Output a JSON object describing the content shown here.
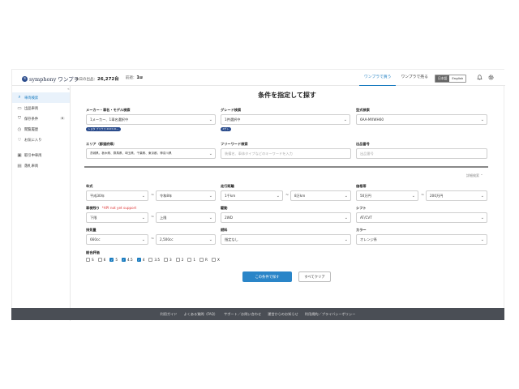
{
  "header": {
    "logo_mark": "s",
    "logo_text": "symphony ワンプラ",
    "stats": [
      {
        "label": "本日の出品：",
        "value": "26,272台"
      },
      {
        "label": "前週：",
        "value": "1u"
      }
    ],
    "tabs": [
      {
        "label": "ワンプラで買う",
        "active": true
      },
      {
        "label": "ワンプラで売る",
        "active": false
      }
    ],
    "lang": {
      "jp": "日本語",
      "en": "English"
    },
    "icons": [
      "bell-icon",
      "gear-icon"
    ]
  },
  "sidebar": {
    "collapse_glyph": "«",
    "items": [
      {
        "label": "車両検索",
        "icon": "search-icon",
        "active": true
      },
      {
        "label": "出品車両",
        "icon": "car-icon",
        "active": false
      },
      {
        "label": "保存条件",
        "icon": "bookmark-icon",
        "active": false,
        "badge": "8"
      },
      {
        "label": "閲覧履歴",
        "icon": "clock-icon",
        "active": false
      },
      {
        "label": "お気に入り",
        "icon": "heart-icon",
        "active": false
      },
      {
        "label": "取引中車両",
        "icon": "deal-icon",
        "active": false
      },
      {
        "label": "落札車両",
        "icon": "document-icon",
        "active": false
      }
    ]
  },
  "form": {
    "title": "条件を指定して探す",
    "maker": {
      "label": "メーカー・車名・モデル検索",
      "value": "1メーカー、1車名選択中",
      "chip": "トヨタ プリウス 2023.01~"
    },
    "grade": {
      "label": "グレード検索",
      "value": "1件選択中",
      "chip": "Zグレ"
    },
    "model_code": {
      "label": "型式検索",
      "value": "6AA-MXWH60"
    },
    "area": {
      "label": "エリア（都道府県）",
      "value": "茨城県、栃木県、群馬県、埼玉県、千葉県、東京都、神奈川県"
    },
    "freeword": {
      "label": "フリーワード検索",
      "placeholder": "装備名、車体タイプなどのキーワードを入力"
    },
    "listing_no": {
      "label": "出品番号",
      "placeholder": "出品番号"
    },
    "detail_toggle": "詳細検索 ⌃",
    "year": {
      "label": "年式",
      "from": "平成30年",
      "to": "令和8年"
    },
    "mileage": {
      "label": "走行距離",
      "from": "1千km",
      "to": "8万km"
    },
    "budget": {
      "label": "価格帯",
      "from": "50万円",
      "to": "200万円"
    },
    "inspection": {
      "label": "車検残り",
      "warn": "*API not yet support",
      "from": "下限",
      "to": "上限"
    },
    "drive": {
      "label": "駆動",
      "value": "2WD"
    },
    "shift": {
      "label": "シフト",
      "value": "AT/CVT"
    },
    "displacement": {
      "label": "排気量",
      "from": "660cc",
      "to": "2,500cc"
    },
    "fuel": {
      "label": "燃料",
      "value": "指定なし"
    },
    "color": {
      "label": "カラー",
      "value": "オレンジ系"
    },
    "rating": {
      "label": "総合評価",
      "options": [
        {
          "label": "S",
          "checked": false
        },
        {
          "label": "6",
          "checked": false
        },
        {
          "label": "5",
          "checked": true
        },
        {
          "label": "4.5",
          "checked": true
        },
        {
          "label": "4",
          "checked": true
        },
        {
          "label": "3.5",
          "checked": false
        },
        {
          "label": "3",
          "checked": false
        },
        {
          "label": "2",
          "checked": false
        },
        {
          "label": "1",
          "checked": false
        },
        {
          "label": "R",
          "checked": false
        },
        {
          "label": "X",
          "checked": false
        }
      ]
    },
    "search_button": "この条件で探す",
    "clear_button": "すべてクリア"
  },
  "footer": {
    "links": [
      "利用ガイド",
      "よくある質問（FAQ）",
      "サポート／お問い合わせ",
      "運営からのお知らせ",
      "利用規約／プライバシーポリシー"
    ]
  }
}
